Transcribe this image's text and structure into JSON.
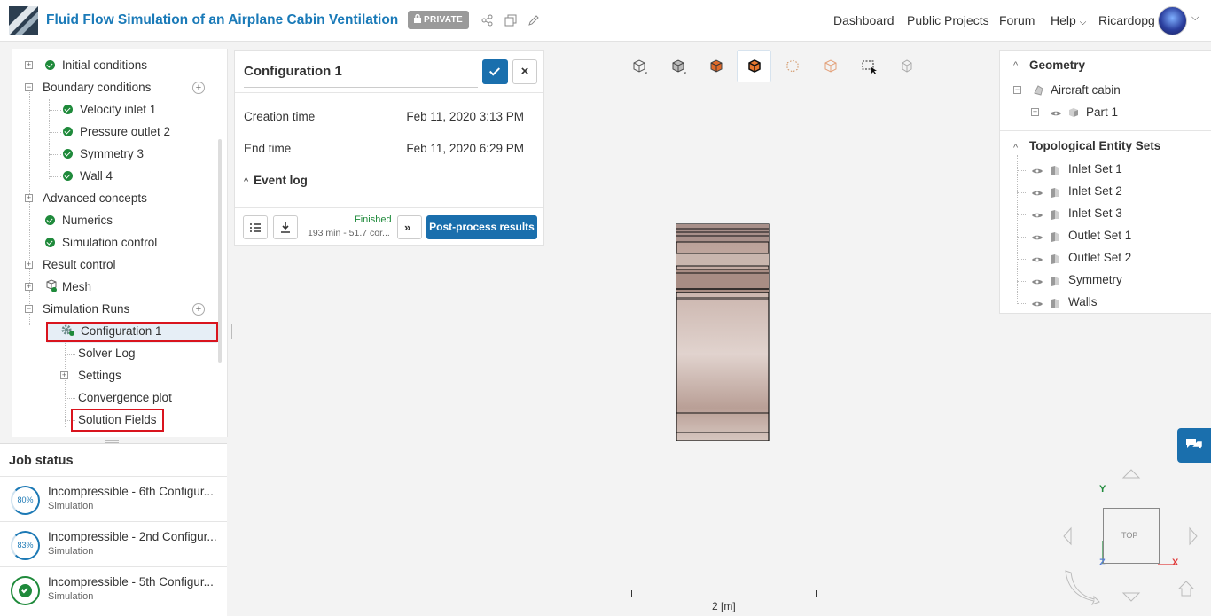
{
  "header": {
    "title": "Fluid Flow Simulation of an Airplane Cabin Ventilation",
    "private_badge": "PRIVATE",
    "nav": [
      "Dashboard",
      "Public Projects",
      "Forum",
      "Help",
      "Ricardopg"
    ]
  },
  "tree": {
    "items": [
      {
        "label": "Initial conditions"
      },
      {
        "label": "Boundary conditions"
      },
      {
        "label": "Velocity inlet 1"
      },
      {
        "label": "Pressure outlet 2"
      },
      {
        "label": "Symmetry 3"
      },
      {
        "label": "Wall 4"
      },
      {
        "label": "Advanced concepts"
      },
      {
        "label": "Numerics"
      },
      {
        "label": "Simulation control"
      },
      {
        "label": "Result control"
      },
      {
        "label": "Mesh"
      },
      {
        "label": "Simulation Runs"
      },
      {
        "label": "Configuration 1"
      },
      {
        "label": "Solver Log"
      },
      {
        "label": "Settings"
      },
      {
        "label": "Convergence plot"
      },
      {
        "label": "Solution Fields"
      }
    ]
  },
  "job_status": {
    "title": "Job status",
    "jobs": [
      {
        "name": "Incompressible - 6th Configur...",
        "type": "Simulation",
        "progress": "80%"
      },
      {
        "name": "Incompressible - 2nd Configur...",
        "type": "Simulation",
        "progress": "83%"
      },
      {
        "name": "Incompressible - 5th Configur...",
        "type": "Simulation",
        "progress": "done"
      }
    ]
  },
  "config": {
    "title": "Configuration 1",
    "creation_label": "Creation time",
    "creation_value": "Feb 11, 2020 3:13 PM",
    "end_label": "End time",
    "end_value": "Feb 11, 2020 6:29 PM",
    "event_log": "Event log",
    "status": "Finished",
    "run_info": "193 min - 51.7 cor...",
    "postprocess": "Post-process results"
  },
  "geometry": {
    "head": "Geometry",
    "cabin": "Aircraft cabin",
    "part": "Part 1",
    "sets_head": "Topological Entity Sets",
    "sets": [
      "Inlet Set 1",
      "Inlet Set 2",
      "Inlet Set 3",
      "Outlet Set 1",
      "Outlet Set 2",
      "Symmetry",
      "Walls"
    ]
  },
  "viewport": {
    "scale_label": "2 [m]",
    "view_label": "TOP",
    "axis_y": "Y",
    "axis_x": "X",
    "axis_z": "Z"
  },
  "colors": {
    "accent": "#1a6fad",
    "title_blue": "#1a7ab8",
    "success": "#1f8a3b",
    "highlight_red": "#d9141e",
    "model_tint": "#c9b3ab"
  }
}
